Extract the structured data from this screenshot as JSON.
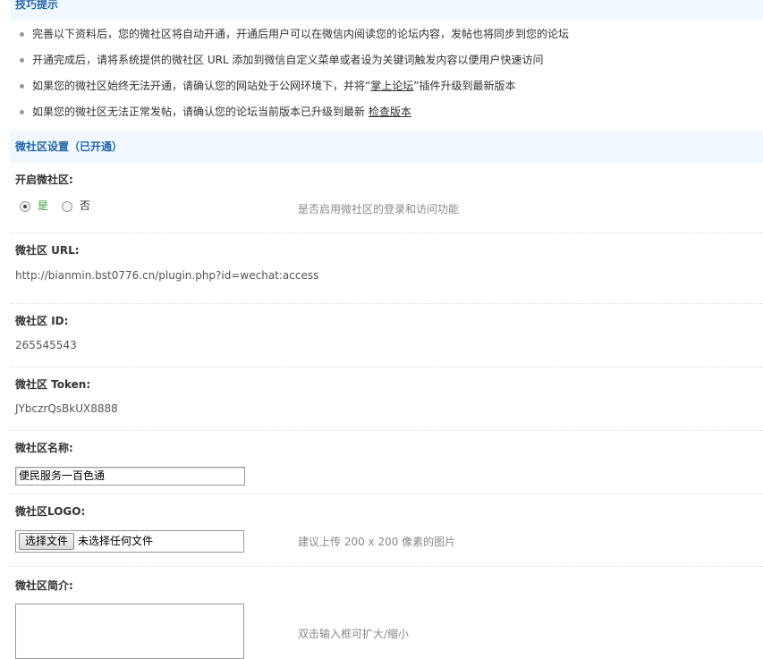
{
  "tips": {
    "title": "技巧提示",
    "items": [
      {
        "text": "完善以下资料后，您的微社区将自动开通，开通后用户可以在微信内阅读您的论坛内容，发帖也将同步到您的论坛"
      },
      {
        "text": "开通完成后，请将系统提供的微社区 URL 添加到微信自定义菜单或者设为关键词触发内容以便用户快速访问"
      },
      {
        "prefix": "如果您的微社区始终无法开通，请确认您的网站处于公网环境下，并将“",
        "link": "掌上论坛",
        "suffix": "”插件升级到最新版本"
      },
      {
        "prefix": "如果您的微社区无法正常发帖，请确认您的论坛当前版本已升级到最新 ",
        "link": "检查版本",
        "suffix": ""
      }
    ]
  },
  "settings": {
    "title": "微社区设置（已开通）",
    "enable": {
      "label": "开启微社区:",
      "option_yes": "是",
      "option_no": "否",
      "selected": "是",
      "hint": "是否启用微社区的登录和访问功能"
    },
    "url": {
      "label": "微社区 URL:",
      "value": "http://bianmin.bst0776.cn/plugin.php?id=wechat:access"
    },
    "id": {
      "label": "微社区 ID:",
      "value": "265545543"
    },
    "token": {
      "label": "微社区 Token:",
      "value": "JYbczrQsBkUX8888"
    },
    "name": {
      "label": "微社区名称:",
      "value": "便民服务一百色通"
    },
    "logo": {
      "label": "微社区LOGO:",
      "button": "选择文件",
      "status": "未选择任何文件",
      "hint": "建议上传 200 x 200 像素的图片"
    },
    "intro": {
      "label": "微社区简介:",
      "value": "",
      "hint": "双击输入框可扩大/缩小"
    }
  }
}
